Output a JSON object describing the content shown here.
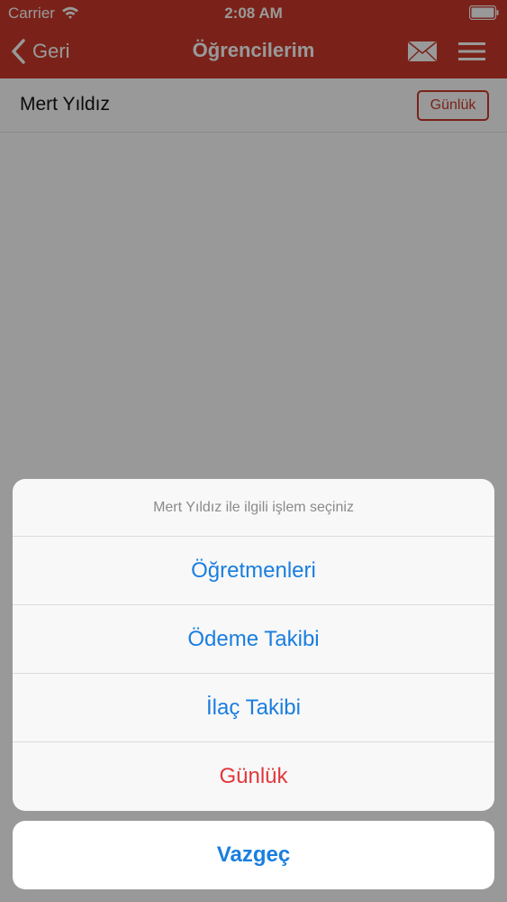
{
  "status_bar": {
    "carrier": "Carrier",
    "time": "2:08 AM"
  },
  "navbar": {
    "back_label": "Geri",
    "title": "Öğrencilerim",
    "color": "#cc3a2b"
  },
  "student": {
    "name": "Mert Yıldız",
    "diary_button_label": "Günlük"
  },
  "action_sheet": {
    "title": "Mert Yıldız ile ilgili işlem seçiniz",
    "options": [
      {
        "label": "Öğretmenleri"
      },
      {
        "label": "Ödeme Takibi"
      },
      {
        "label": "İlaç Takibi"
      },
      {
        "label": "Günlük"
      }
    ],
    "cancel_label": "Vazgeç",
    "accent_color": "#1a7ee0",
    "destructive_color": "#e0383c"
  },
  "icons": {
    "wifi": "wifi-icon",
    "battery": "battery-icon",
    "back": "chevron-left-icon",
    "mail": "mail-icon",
    "menu": "hamburger-menu-icon"
  }
}
